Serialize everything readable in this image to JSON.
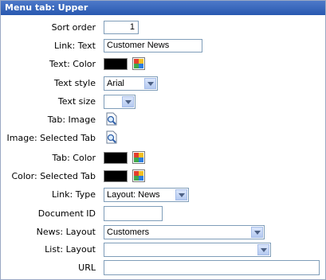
{
  "header": {
    "title": "Menu tab: Upper"
  },
  "rows": {
    "sort_order": {
      "label": "Sort order",
      "value": "1"
    },
    "link_text": {
      "label": "Link: Text",
      "value": "Customer News"
    },
    "text_color": {
      "label": "Text: Color",
      "color": "#000000"
    },
    "text_style": {
      "label": "Text style",
      "value": "Arial"
    },
    "text_size": {
      "label": "Text size",
      "value": ""
    },
    "tab_image": {
      "label": "Tab: Image"
    },
    "image_selected_tab": {
      "label": "Image: Selected Tab"
    },
    "tab_color": {
      "label": "Tab: Color",
      "color": "#000000"
    },
    "color_selected_tab": {
      "label": "Color: Selected Tab",
      "color": "#000000"
    },
    "link_type": {
      "label": "Link: Type",
      "value": "Layout: News"
    },
    "document_id": {
      "label": "Document ID",
      "value": ""
    },
    "news_layout": {
      "label": "News: Layout",
      "value": "Customers"
    },
    "list_layout": {
      "label": "List: Layout",
      "value": ""
    },
    "url": {
      "label": "URL",
      "value": ""
    }
  },
  "icons": {
    "color_picker": "color-picker-icon",
    "image_browse": "image-browse-icon",
    "dropdown_arrow": "chevron-down-icon"
  }
}
